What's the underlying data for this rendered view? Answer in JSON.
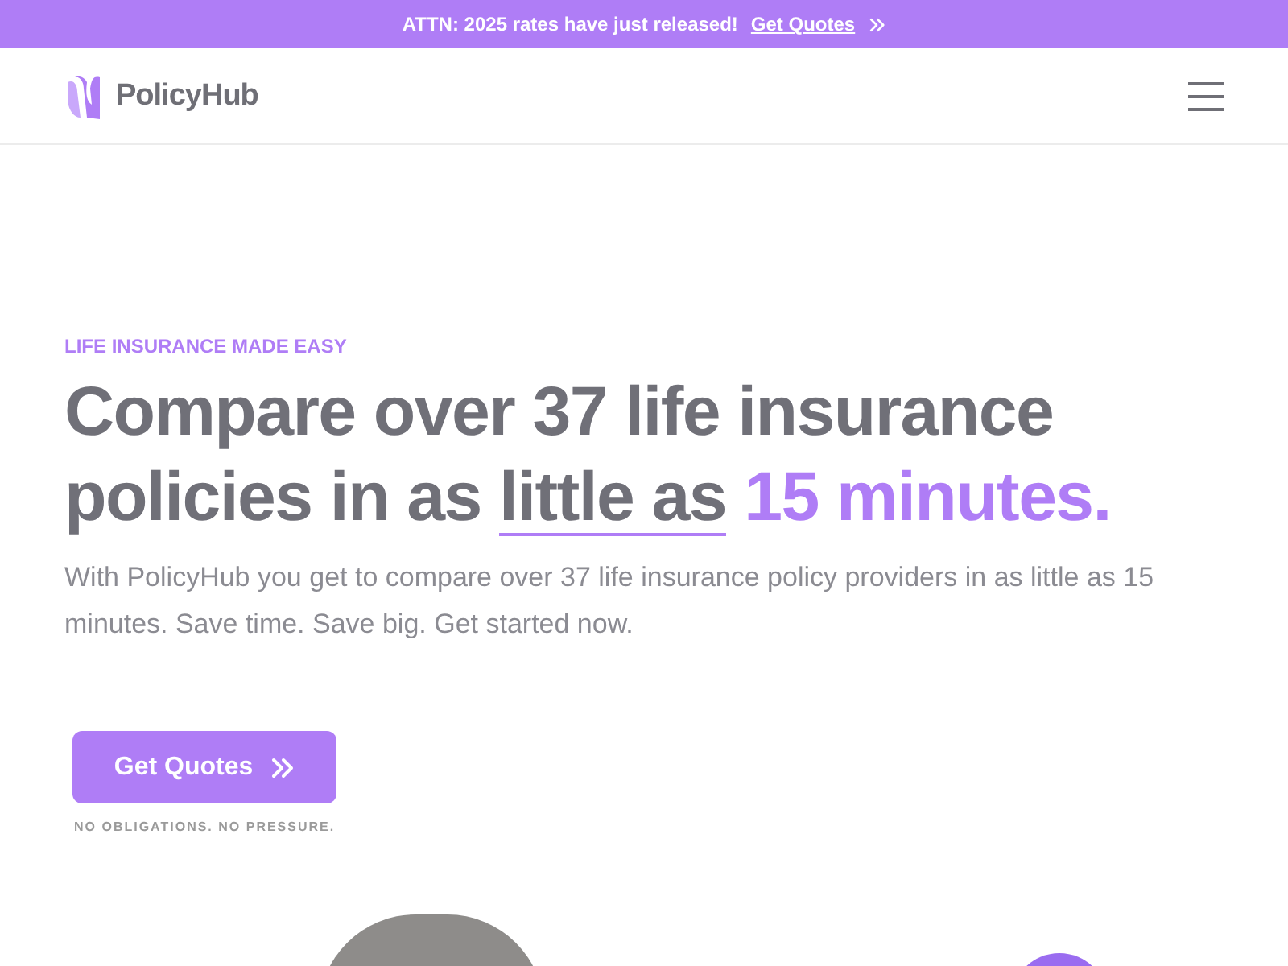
{
  "banner": {
    "text": "ATTN: 2025 rates have just released!",
    "link": "Get Quotes"
  },
  "header": {
    "logo": "PolicyHub"
  },
  "hero": {
    "eyebrow": "LIFE INSURANCE MADE EASY",
    "heading": {
      "text": "Compare over 37 life insurance policies in as",
      "underlined": "little as",
      "highlight": "15 minutes."
    },
    "description": "With PolicyHub you get to compare over 37 life insurance policy providers in as little as 15 minutes. Save time. Save big. Get started now.",
    "button": "Get Quotes",
    "note": "NO OBLIGATIONS. NO PRESSURE."
  }
}
